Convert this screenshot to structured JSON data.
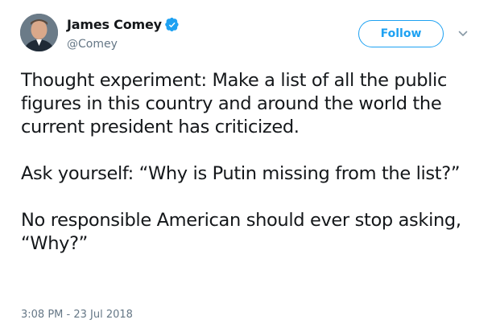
{
  "author": {
    "display_name": "James Comey",
    "handle": "@Comey",
    "verified": true
  },
  "follow_button": {
    "label": "Follow"
  },
  "tweet": {
    "paragraphs": [
      "Thought experiment: Make a list of all the public figures in this country and around the world the current president has criticized.",
      "Ask yourself: “Why is Putin missing from the list?”",
      "No responsible American should ever stop asking, “Why?”"
    ],
    "timestamp": "3:08 PM - 23 Jul 2018"
  },
  "icons": {
    "verified": "verified-badge-icon",
    "menu": "chevron-down-icon"
  },
  "colors": {
    "accent": "#1da1f2",
    "text": "#14171a",
    "secondary": "#657786"
  }
}
